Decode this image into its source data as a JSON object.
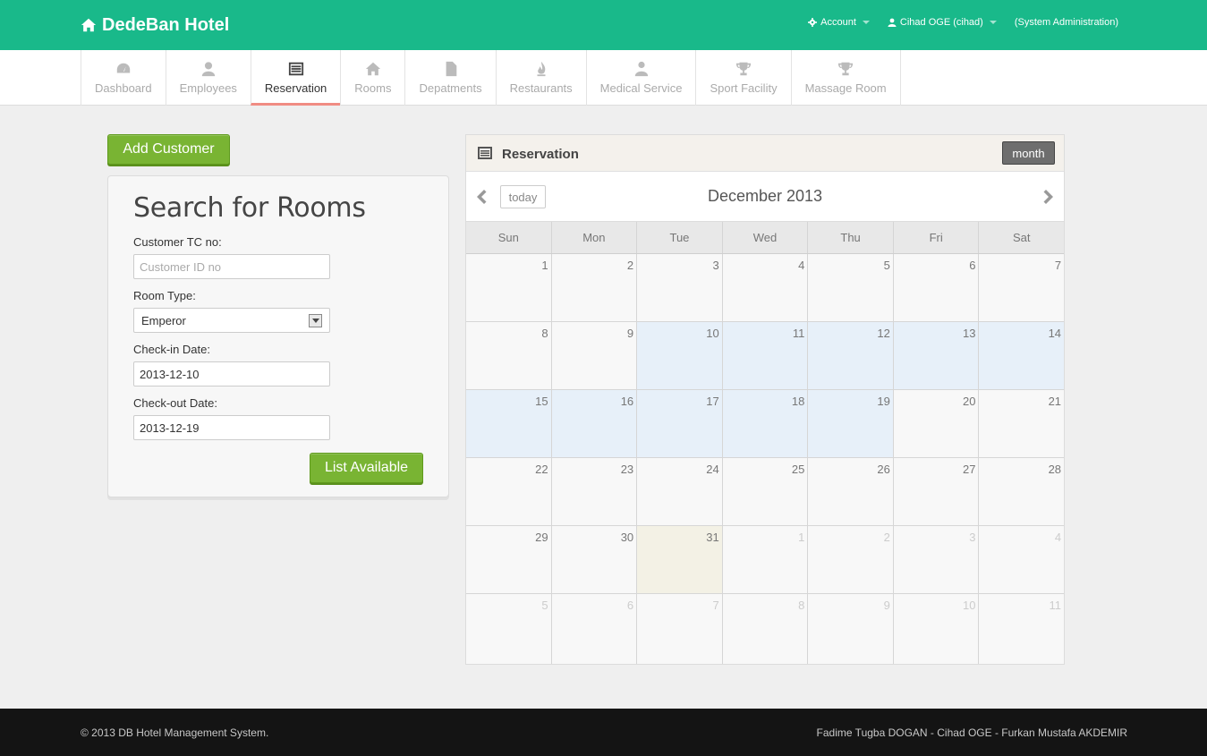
{
  "header": {
    "brand": "DedeBan Hotel",
    "account_label": "Account",
    "user_label": "Cihad OGE (cihad)",
    "role_label": "(System Administration)"
  },
  "tabs": [
    {
      "label": "Dashboard",
      "icon": "dashboard-icon"
    },
    {
      "label": "Employees",
      "icon": "user-icon"
    },
    {
      "label": "Reservation",
      "icon": "list-icon",
      "active": true
    },
    {
      "label": "Rooms",
      "icon": "home-icon"
    },
    {
      "label": "Depatments",
      "icon": "file-icon"
    },
    {
      "label": "Restaurants",
      "icon": "fire-icon"
    },
    {
      "label": "Medical Service",
      "icon": "doctor-icon"
    },
    {
      "label": "Sport Facility",
      "icon": "trophy-icon"
    },
    {
      "label": "Massage Room",
      "icon": "trophy-icon"
    }
  ],
  "left": {
    "add_customer": "Add Customer",
    "search_title": "Search for Rooms",
    "tc_label": "Customer TC no:",
    "tc_placeholder": "Customer ID no",
    "room_type_label": "Room Type:",
    "room_type_value": "Emperor",
    "checkin_label": "Check-in Date:",
    "checkin_value": "2013-12-10",
    "checkout_label": "Check-out Date:",
    "checkout_value": "2013-12-19",
    "list_available": "List Available"
  },
  "calendar": {
    "panel_title": "Reservation",
    "month_button": "month",
    "today_button": "today",
    "title": "December 2013",
    "days_of_week": [
      "Sun",
      "Mon",
      "Tue",
      "Wed",
      "Thu",
      "Fri",
      "Sat"
    ],
    "weeks": [
      [
        {
          "d": "1"
        },
        {
          "d": "2"
        },
        {
          "d": "3"
        },
        {
          "d": "4"
        },
        {
          "d": "5"
        },
        {
          "d": "6"
        },
        {
          "d": "7"
        }
      ],
      [
        {
          "d": "8"
        },
        {
          "d": "9"
        },
        {
          "d": "10",
          "hl": true
        },
        {
          "d": "11",
          "hl": true
        },
        {
          "d": "12",
          "hl": true
        },
        {
          "d": "13",
          "hl": true
        },
        {
          "d": "14",
          "hl": true
        }
      ],
      [
        {
          "d": "15",
          "hl": true
        },
        {
          "d": "16",
          "hl": true
        },
        {
          "d": "17",
          "hl": true
        },
        {
          "d": "18",
          "hl": true
        },
        {
          "d": "19",
          "hl": true
        },
        {
          "d": "20"
        },
        {
          "d": "21"
        }
      ],
      [
        {
          "d": "22"
        },
        {
          "d": "23"
        },
        {
          "d": "24"
        },
        {
          "d": "25"
        },
        {
          "d": "26"
        },
        {
          "d": "27"
        },
        {
          "d": "28"
        }
      ],
      [
        {
          "d": "29"
        },
        {
          "d": "30"
        },
        {
          "d": "31",
          "today": true
        },
        {
          "d": "1",
          "other": true
        },
        {
          "d": "2",
          "other": true
        },
        {
          "d": "3",
          "other": true
        },
        {
          "d": "4",
          "other": true
        }
      ],
      [
        {
          "d": "5",
          "other": true
        },
        {
          "d": "6",
          "other": true
        },
        {
          "d": "7",
          "other": true
        },
        {
          "d": "8",
          "other": true
        },
        {
          "d": "9",
          "other": true
        },
        {
          "d": "10",
          "other": true
        },
        {
          "d": "11",
          "other": true
        }
      ]
    ]
  },
  "footer": {
    "copyright": "© 2013 DB Hotel Management System.",
    "authors": "Fadime Tugba DOGAN - Cihad OGE - Furkan Mustafa AKDEMIR"
  },
  "colors": {
    "header": "#19b98a",
    "button_green": "#79b433",
    "active_tab_underline": "#f08c83",
    "highlight_day": "#e7f0f9",
    "today_day": "#f3f1e5"
  }
}
